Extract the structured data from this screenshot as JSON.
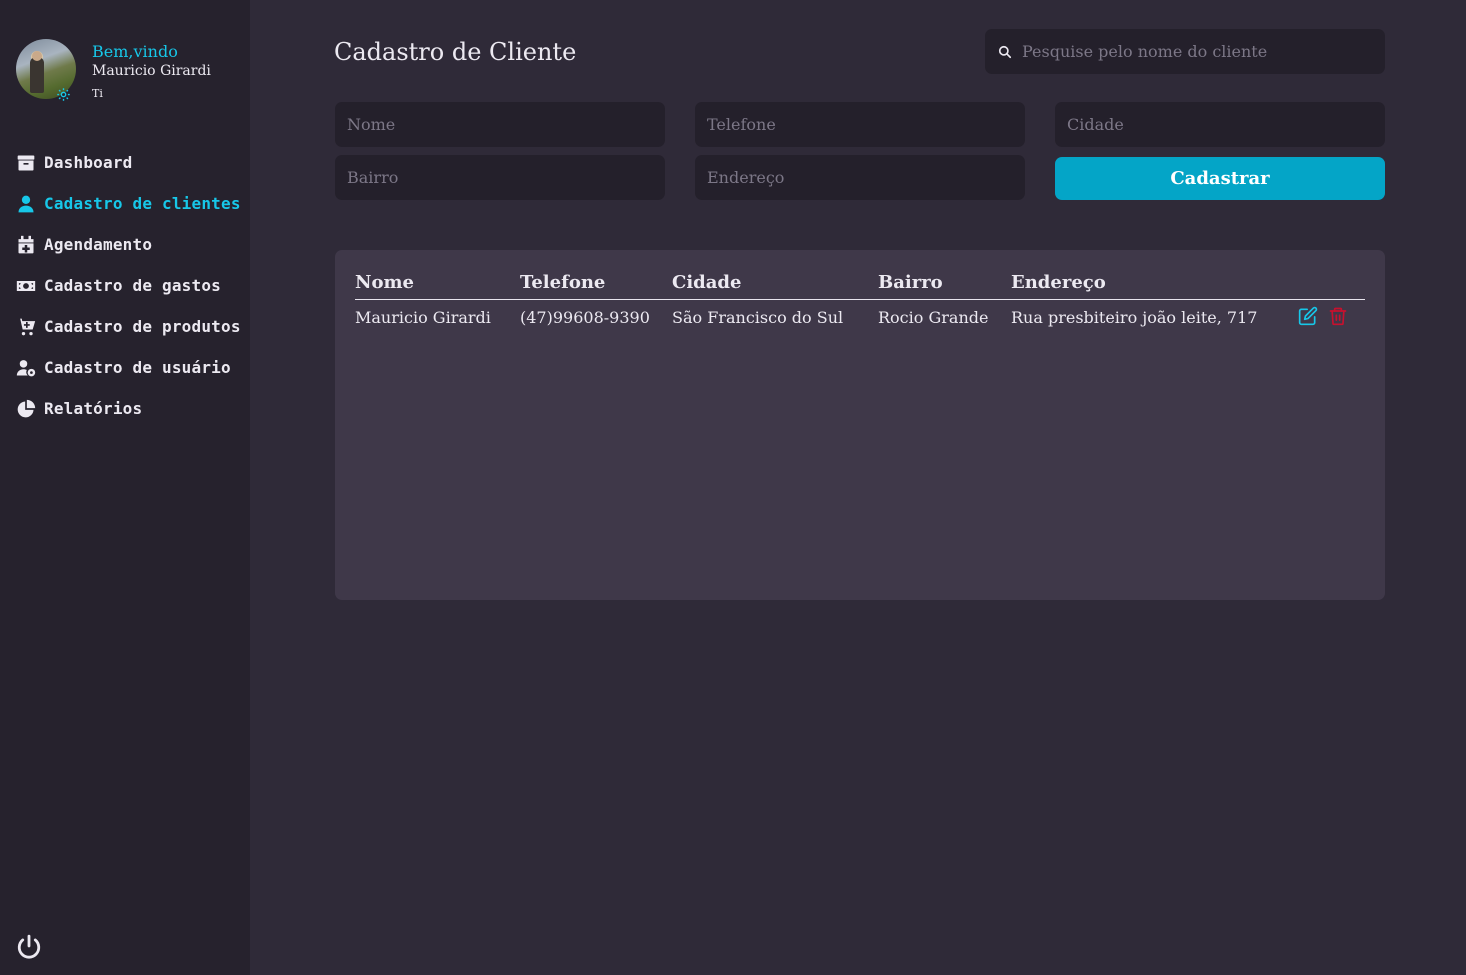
{
  "sidebar": {
    "welcome": "Bem,vindo",
    "user_name": "Mauricio Girardi",
    "user_role": "Ti",
    "items": [
      {
        "label": "Dashboard",
        "icon": "archive-icon"
      },
      {
        "label": "Cadastro de clientes",
        "icon": "user-icon",
        "active": true
      },
      {
        "label": "Agendamento",
        "icon": "calendar-plus-icon"
      },
      {
        "label": "Cadastro de gastos",
        "icon": "money-bill-icon"
      },
      {
        "label": "Cadastro de produtos",
        "icon": "cart-plus-icon"
      },
      {
        "label": "Cadastro de usuário",
        "icon": "user-gear-icon"
      },
      {
        "label": "Relatórios",
        "icon": "pie-chart-icon"
      }
    ]
  },
  "header": {
    "title": "Cadastro de Cliente",
    "search_placeholder": "Pesquise pelo nome do cliente"
  },
  "form": {
    "nome_placeholder": "Nome",
    "telefone_placeholder": "Telefone",
    "cidade_placeholder": "Cidade",
    "bairro_placeholder": "Bairro",
    "endereco_placeholder": "Endereço",
    "submit_label": "Cadastrar"
  },
  "table": {
    "columns": [
      "Nome",
      "Telefone",
      "Cidade",
      "Bairro",
      "Endereço"
    ],
    "rows": [
      [
        "Mauricio Girardi",
        "(47)99608-9390",
        "São Francisco do Sul",
        "Rocio Grande",
        "Rua presbiteiro joão leite, 717"
      ]
    ]
  },
  "colors": {
    "accent": "#17c7e8",
    "button": "#04a5c7",
    "delete": "#c8102e",
    "sidebar_bg": "#26222d",
    "main_bg": "#2f2a38"
  }
}
